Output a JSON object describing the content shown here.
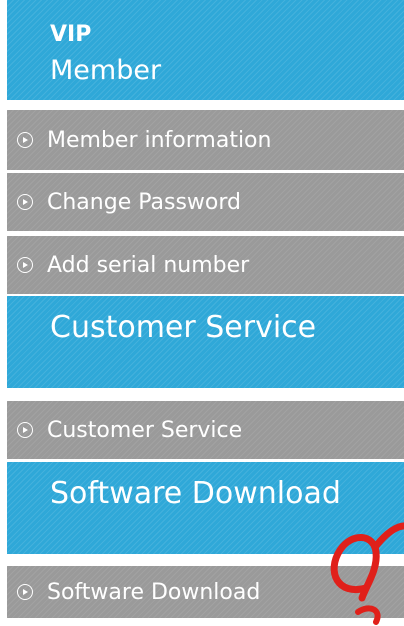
{
  "vip_section": {
    "title_line1": "VIP",
    "title_line2": "Member",
    "items": [
      {
        "label": "Member information",
        "icon": "arrow-circle-icon"
      },
      {
        "label": "Change Password",
        "icon": "arrow-circle-icon"
      },
      {
        "label": "Add serial number",
        "icon": "arrow-circle-icon"
      }
    ]
  },
  "customer_section": {
    "title": "Customer Service",
    "items": [
      {
        "label": "Customer Service",
        "icon": "arrow-circle-icon"
      }
    ]
  },
  "software_section": {
    "title": "Software Download",
    "items": [
      {
        "label": "Software Download",
        "icon": "arrow-circle-icon"
      }
    ]
  },
  "colors": {
    "header_blue": "#2fa8d8",
    "menu_gray": "#9a9a9a",
    "text": "#ffffff",
    "watermark": "#e0201a"
  }
}
